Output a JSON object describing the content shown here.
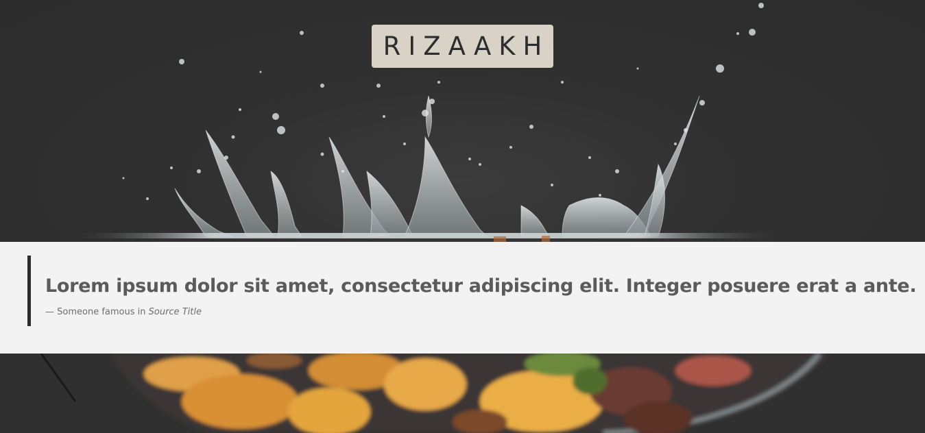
{
  "header": {
    "brand": "RIZAAKH"
  },
  "hero_image": {
    "subject": "water-splash"
  },
  "quote": {
    "text": "Lorem ipsum dolor sit amet, consectetur adipiscing elit. Integer posuere erat a ante.",
    "footer_prefix": "— Someone famous in ",
    "source_title": "Source Title"
  },
  "food_image": {
    "subject": "food-pan"
  },
  "colors": {
    "hero_bg": "#303030",
    "brand_bg": "#d9d3c7",
    "quote_bg": "#f3f3f3",
    "quote_bar": "#2c2c2c",
    "quote_text": "#5b5b5b"
  }
}
